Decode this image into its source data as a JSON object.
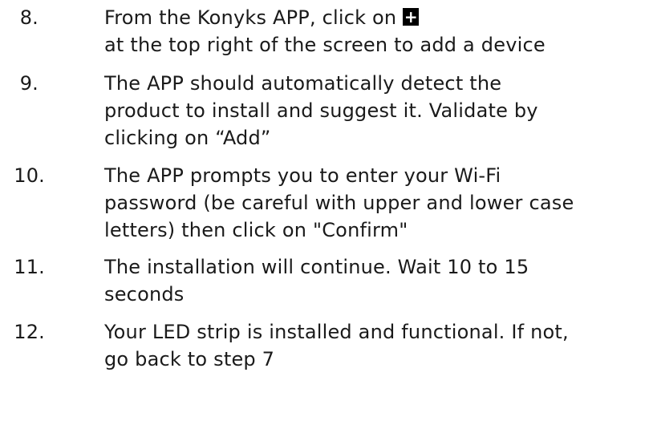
{
  "steps": [
    {
      "number": "8.",
      "lines": [
        "From the Konyks APP, click on",
        "at the top right of the screen to add a device"
      ],
      "icon": "plus-icon",
      "icon_glyph": "+"
    },
    {
      "number": "9.",
      "lines": [
        "The APP should automatically detect the",
        "product to install and suggest it. Validate by",
        "clicking on “Add”"
      ]
    },
    {
      "number": "10.",
      "lines": [
        "The APP prompts you to enter your Wi-Fi",
        "password (be careful with upper and lower case",
        "letters) then click on \"Confirm\""
      ]
    },
    {
      "number": "11.",
      "lines": [
        "The installation will continue. Wait 10 to 15",
        "seconds"
      ]
    },
    {
      "number": "12.",
      "lines": [
        "Your LED strip is installed and functional. If not,",
        "go back to step 7"
      ]
    }
  ]
}
